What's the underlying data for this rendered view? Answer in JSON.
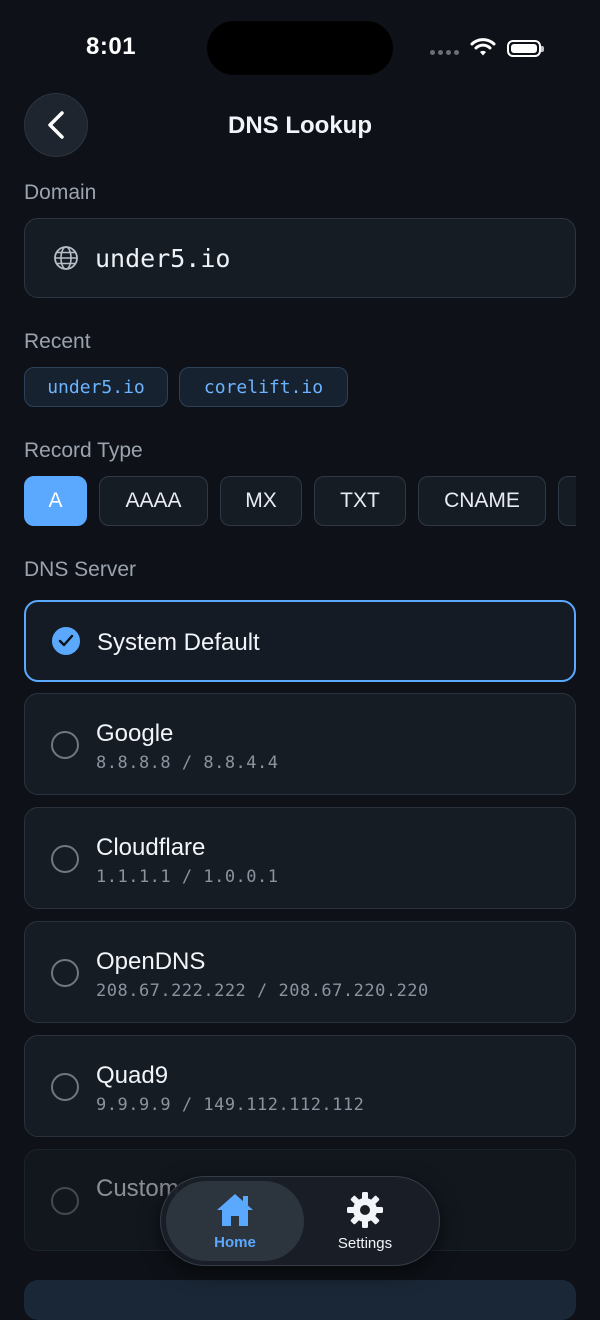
{
  "status_bar": {
    "time": "8:01"
  },
  "header": {
    "title": "DNS Lookup"
  },
  "domain": {
    "label": "Domain",
    "value": "under5.io"
  },
  "recent": {
    "label": "Recent",
    "items": [
      "under5.io",
      "corelift.io"
    ]
  },
  "record_type": {
    "label": "Record Type",
    "options": [
      "A",
      "AAAA",
      "MX",
      "TXT",
      "CNAME"
    ],
    "selected": "A"
  },
  "dns_server": {
    "label": "DNS Server",
    "servers": [
      {
        "name": "System Default",
        "ip": "",
        "selected": true
      },
      {
        "name": "Google",
        "ip": "8.8.8.8 / 8.8.4.4",
        "selected": false
      },
      {
        "name": "Cloudflare",
        "ip": "1.1.1.1 / 1.0.0.1",
        "selected": false
      },
      {
        "name": "OpenDNS",
        "ip": "208.67.222.222 / 208.67.220.220",
        "selected": false
      },
      {
        "name": "Quad9",
        "ip": "9.9.9.9 / 149.112.112.112",
        "selected": false
      },
      {
        "name": "Custom",
        "ip": "",
        "selected": false
      }
    ]
  },
  "tabbar": {
    "items": [
      {
        "label": "Home",
        "active": true
      },
      {
        "label": "Settings",
        "active": false
      }
    ]
  },
  "colors": {
    "accent": "#5aa9ff",
    "background": "#0e1218",
    "card": "#161c24"
  }
}
